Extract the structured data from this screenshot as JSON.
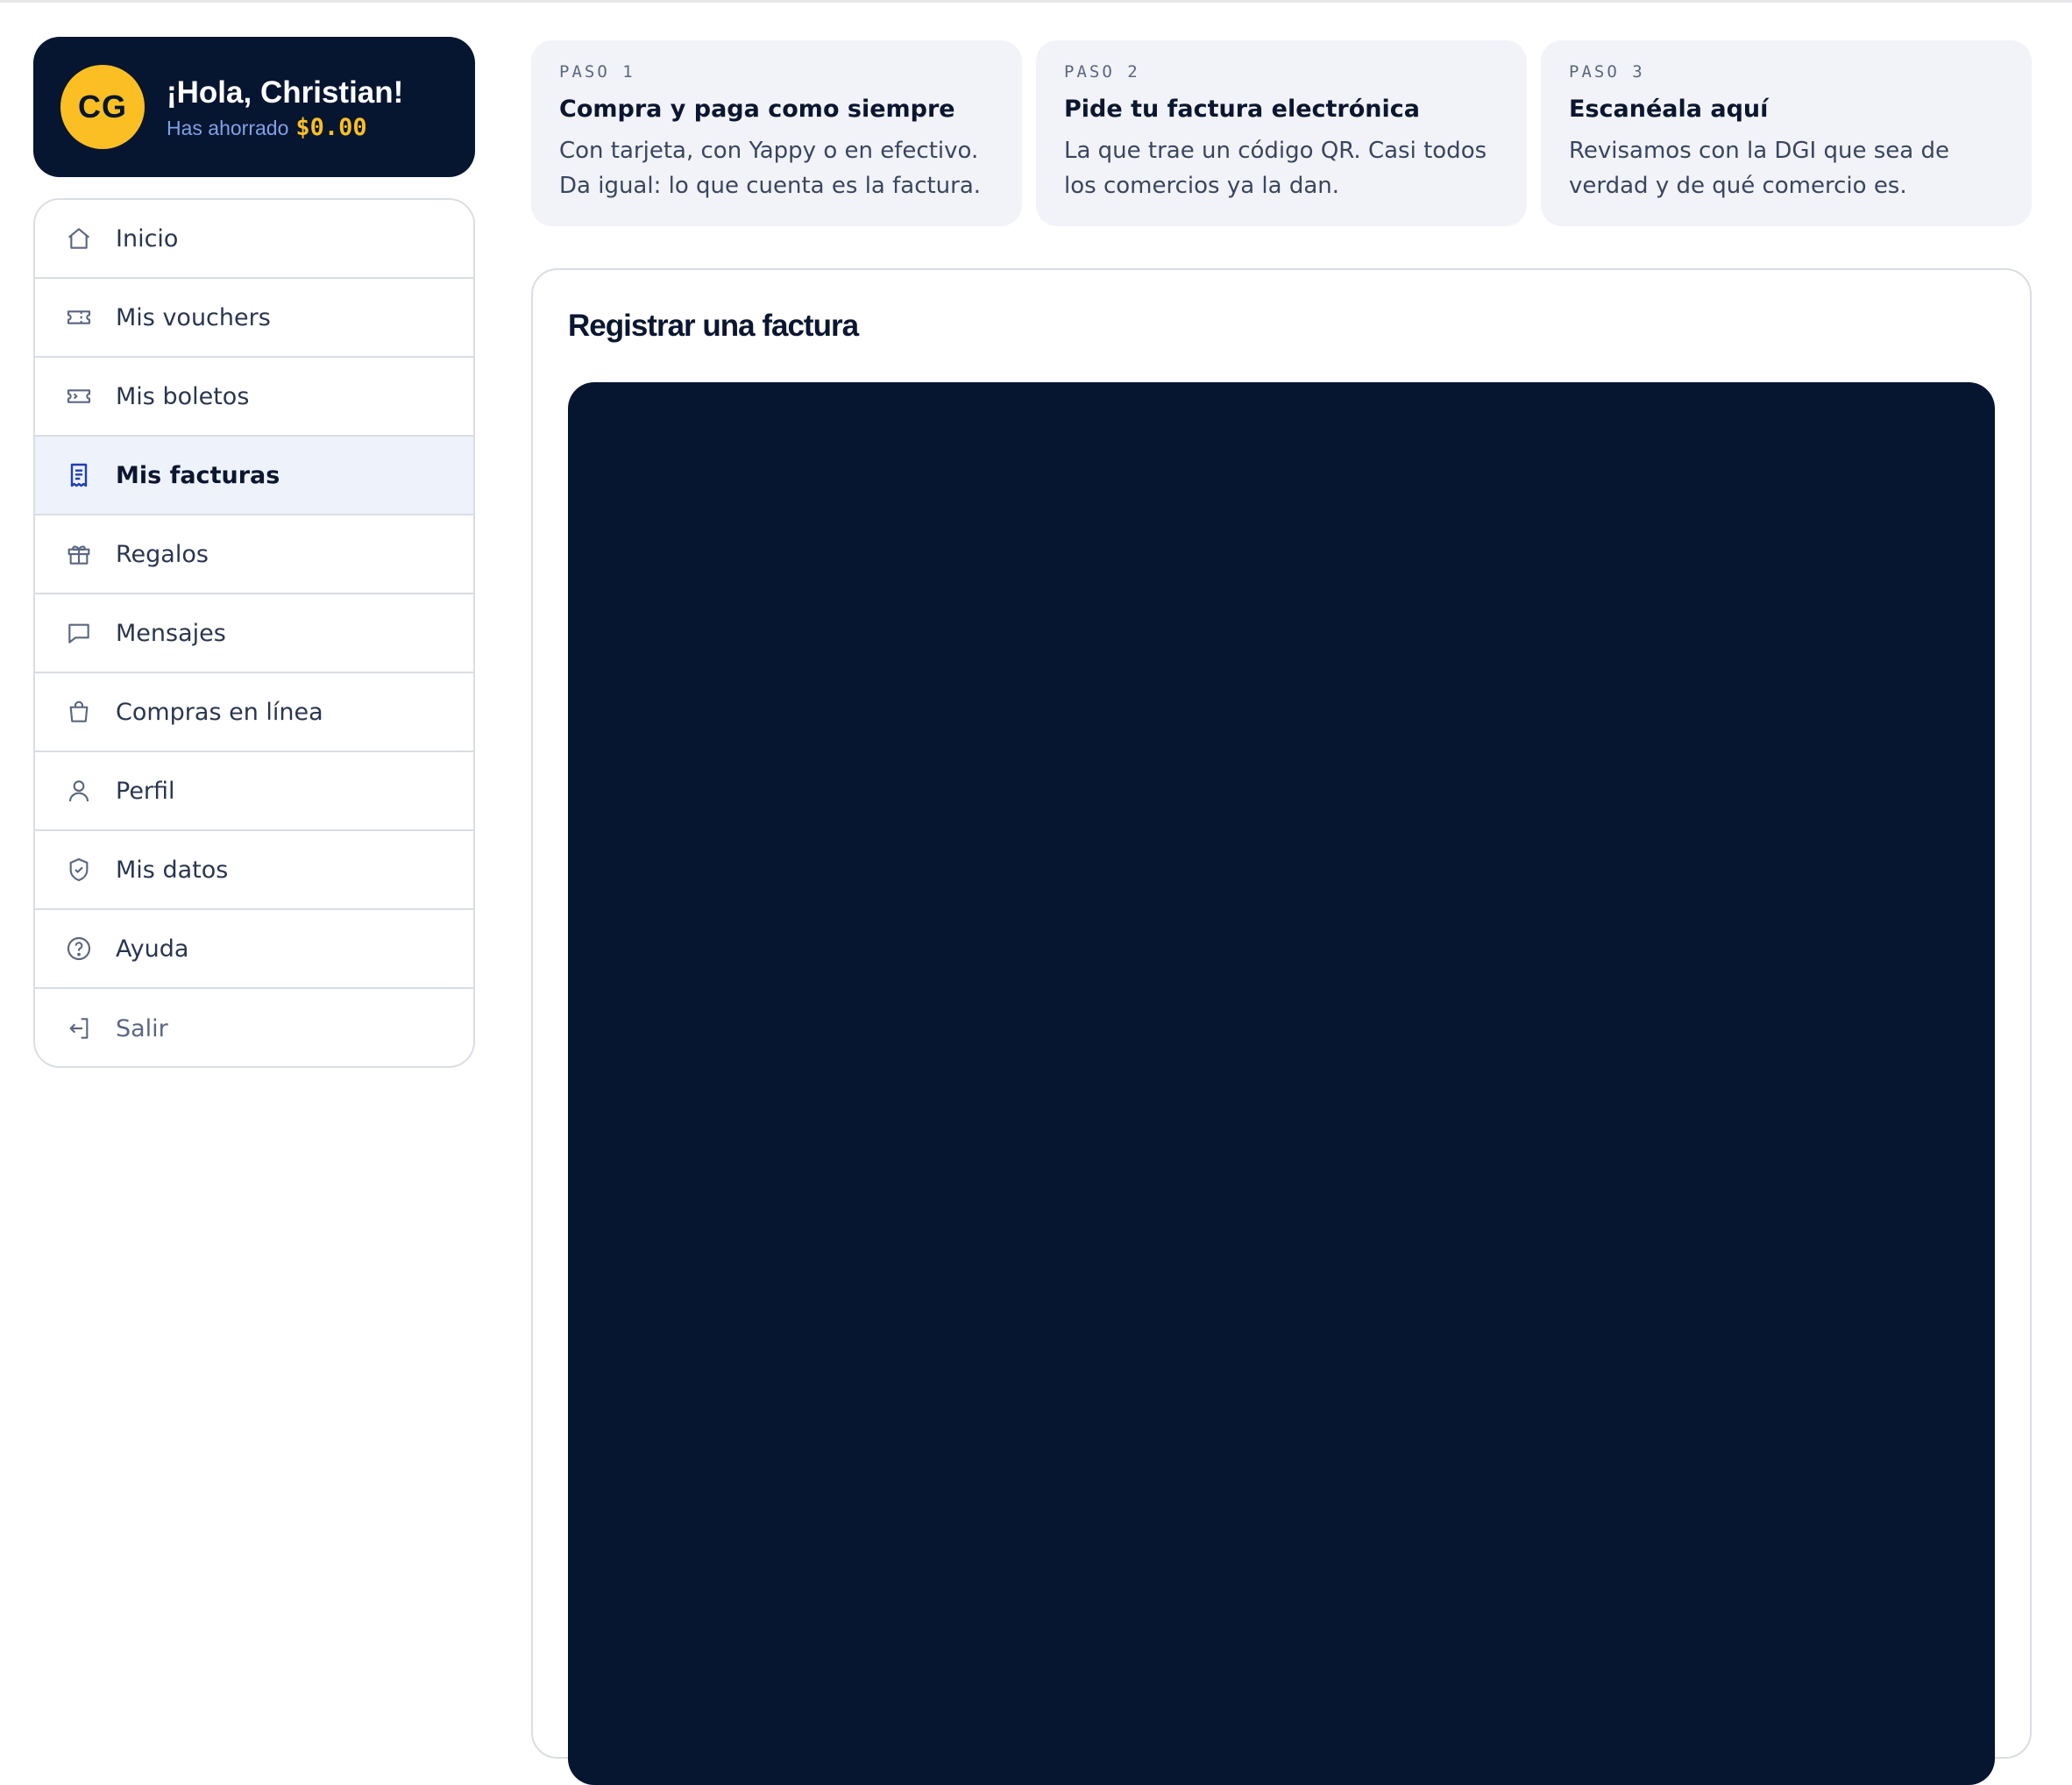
{
  "profile": {
    "initials": "CG",
    "greeting": "¡Hola, Christian!",
    "savings_label": "Has ahorrado",
    "savings_amount": "$0.00"
  },
  "nav": {
    "items": [
      {
        "label": "Inicio",
        "icon": "home-icon"
      },
      {
        "label": "Mis vouchers",
        "icon": "voucher-icon"
      },
      {
        "label": "Mis boletos",
        "icon": "ticket-icon"
      },
      {
        "label": "Mis facturas",
        "icon": "receipt-icon",
        "active": true
      },
      {
        "label": "Regalos",
        "icon": "gift-icon"
      },
      {
        "label": "Mensajes",
        "icon": "message-icon"
      },
      {
        "label": "Compras en línea",
        "icon": "shopping-bag-icon"
      },
      {
        "label": "Perfil",
        "icon": "user-icon"
      },
      {
        "label": "Mis datos",
        "icon": "shield-check-icon"
      },
      {
        "label": "Ayuda",
        "icon": "help-circle-icon"
      },
      {
        "label": "Salir",
        "icon": "logout-icon"
      }
    ]
  },
  "steps": [
    {
      "kicker": "PASO 1",
      "title": "Compra y paga como siempre",
      "description": "Con tarjeta, con Yappy o en efectivo. Da igual: lo que cuenta es la factura."
    },
    {
      "kicker": "PASO 2",
      "title": "Pide tu factura electrónica",
      "description": "La que trae un código QR. Casi todos los comercios ya la dan."
    },
    {
      "kicker": "PASO 3",
      "title": "Escanéala aquí",
      "description": "Revisamos con la DGI que sea de verdad y de qué comercio es."
    }
  ],
  "main": {
    "title": "Registrar una factura"
  },
  "colors": {
    "navy": "#061530",
    "accent_yellow": "#fbbf24",
    "active_icon": "#1d3fb8",
    "active_bg": "#eef2fb"
  }
}
